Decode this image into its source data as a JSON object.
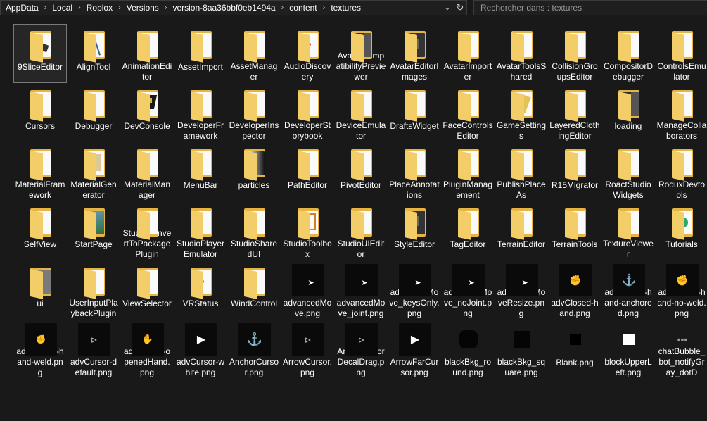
{
  "address": {
    "crumbs": [
      "AppData",
      "Local",
      "Roblox",
      "Versions",
      "version-8aa36bbf0eb1494a",
      "content",
      "textures"
    ],
    "separator": "›",
    "dropdown_icon": "chevron-down-icon",
    "refresh_icon": "refresh-icon"
  },
  "search": {
    "placeholder": "Rechercher dans : textures"
  },
  "accent_folder": "#e6b444",
  "items": [
    {
      "label": "9SliceEditor",
      "kind": "folder",
      "selected": true,
      "preview": "9slice"
    },
    {
      "label": "AlignTool",
      "kind": "folder",
      "preview": "align"
    },
    {
      "label": "AnimationEditor",
      "kind": "folder",
      "preview": "dot"
    },
    {
      "label": "AssetImport",
      "kind": "folder",
      "preview": "blank"
    },
    {
      "label": "AssetManager",
      "kind": "folder",
      "preview": "dot"
    },
    {
      "label": "AudioDiscovery",
      "kind": "folder",
      "preview": "red"
    },
    {
      "label": "AvatarCompatibilityPreviewer",
      "kind": "folder",
      "preview": "dark"
    },
    {
      "label": "AvatarEditorImages",
      "kind": "folder",
      "preview": "darkgrid"
    },
    {
      "label": "AvatarImporter",
      "kind": "folder",
      "preview": "dot"
    },
    {
      "label": "AvatarToolsShared",
      "kind": "folder",
      "preview": "dot"
    },
    {
      "label": "CollisionGroupsEditor",
      "kind": "folder",
      "preview": "dot"
    },
    {
      "label": "CompositorDebugger",
      "kind": "folder",
      "preview": "dot"
    },
    {
      "label": "ControlsEmulator",
      "kind": "folder",
      "preview": "blank"
    },
    {
      "label": "Cursors",
      "kind": "folder",
      "preview": "blank"
    },
    {
      "label": "Debugger",
      "kind": "folder",
      "preview": "dot"
    },
    {
      "label": "DevConsole",
      "kind": "folder",
      "preview": "devconsole"
    },
    {
      "label": "DeveloperFramework",
      "kind": "folder",
      "preview": "dot"
    },
    {
      "label": "DeveloperInspector",
      "kind": "folder",
      "preview": "dot"
    },
    {
      "label": "DeveloperStorybook",
      "kind": "folder",
      "preview": "blue"
    },
    {
      "label": "DeviceEmulator",
      "kind": "folder",
      "preview": "dot"
    },
    {
      "label": "DraftsWidget",
      "kind": "folder",
      "preview": "dot"
    },
    {
      "label": "FaceControlsEditor",
      "kind": "folder",
      "preview": "dot"
    },
    {
      "label": "GameSettings",
      "kind": "folder",
      "preview": "gold"
    },
    {
      "label": "LayeredClothingEditor",
      "kind": "folder",
      "preview": "dot"
    },
    {
      "label": "loading",
      "kind": "folder",
      "preview": "dark"
    },
    {
      "label": "ManageCollaborators",
      "kind": "folder",
      "preview": "blank"
    },
    {
      "label": "MaterialFramework",
      "kind": "folder",
      "preview": "blank"
    },
    {
      "label": "MaterialGenerator",
      "kind": "folder",
      "preview": "sketch"
    },
    {
      "label": "MaterialManager",
      "kind": "folder",
      "preview": "dot"
    },
    {
      "label": "MenuBar",
      "kind": "folder",
      "preview": "blank"
    },
    {
      "label": "particles",
      "kind": "folder",
      "preview": "gradient"
    },
    {
      "label": "PathEditor",
      "kind": "folder",
      "preview": "dot"
    },
    {
      "label": "PivotEditor",
      "kind": "folder",
      "preview": "dot"
    },
    {
      "label": "PlaceAnnotations",
      "kind": "folder",
      "preview": "dot"
    },
    {
      "label": "PluginManagement",
      "kind": "folder",
      "preview": "dot"
    },
    {
      "label": "PublishPlaceAs",
      "kind": "folder",
      "preview": "blue"
    },
    {
      "label": "R15Migrator",
      "kind": "folder",
      "preview": "dot"
    },
    {
      "label": "RoactStudioWidgets",
      "kind": "folder",
      "preview": "dot"
    },
    {
      "label": "RoduxDevtools",
      "kind": "folder",
      "preview": "blank"
    },
    {
      "label": "SelfView",
      "kind": "folder",
      "preview": "blank"
    },
    {
      "label": "StartPage",
      "kind": "folder",
      "preview": "green"
    },
    {
      "label": "StudioConvertToPackagePlugin",
      "kind": "folder",
      "preview": "blank"
    },
    {
      "label": "StudioPlayerEmulator",
      "kind": "folder",
      "preview": "dot"
    },
    {
      "label": "StudioSharedUI",
      "kind": "folder",
      "preview": "dot"
    },
    {
      "label": "StudioToolbox",
      "kind": "folder",
      "preview": "orange"
    },
    {
      "label": "StudioUIEditor",
      "kind": "folder",
      "preview": "dot"
    },
    {
      "label": "StyleEditor",
      "kind": "folder",
      "preview": "darkgrid"
    },
    {
      "label": "TagEditor",
      "kind": "folder",
      "preview": "dot"
    },
    {
      "label": "TerrainEditor",
      "kind": "folder",
      "preview": "dot"
    },
    {
      "label": "TerrainTools",
      "kind": "folder",
      "preview": "blank"
    },
    {
      "label": "TextureViewer",
      "kind": "folder",
      "preview": "blank"
    },
    {
      "label": "Tutorials",
      "kind": "folder",
      "preview": "check"
    },
    {
      "label": "ui",
      "kind": "folder",
      "preview": "ui"
    },
    {
      "label": "UserInputPlaybackPlugin",
      "kind": "folder",
      "preview": "blank"
    },
    {
      "label": "ViewSelector",
      "kind": "folder",
      "preview": "dot"
    },
    {
      "label": "VRStatus",
      "kind": "folder",
      "preview": "greendot"
    },
    {
      "label": "WindControl",
      "kind": "folder",
      "preview": "blank"
    },
    {
      "label": "advancedMove.png",
      "kind": "image",
      "glyph": "cursor-arrow-icon"
    },
    {
      "label": "advancedMove_joint.png",
      "kind": "image",
      "glyph": "cursor-arrow-icon"
    },
    {
      "label": "advancedMove_keysOnly.png",
      "kind": "image",
      "glyph": "cursor-arrow-icon"
    },
    {
      "label": "advancedMove_noJoint.png",
      "kind": "image",
      "glyph": "cursor-arrow-icon"
    },
    {
      "label": "advancedMoveResize.png",
      "kind": "image",
      "glyph": "cursor-arrow-icon"
    },
    {
      "label": "advClosed-hand.png",
      "kind": "image",
      "glyph": "closed-hand-icon"
    },
    {
      "label": "advClosed-hand-anchored.png",
      "kind": "image",
      "glyph": "anchor-hand-icon"
    },
    {
      "label": "advClosed-hand-no-weld.png",
      "kind": "image",
      "glyph": "closed-hand-icon"
    },
    {
      "label": "advClosed-hand-weld.png",
      "kind": "image",
      "glyph": "weld-hand-icon"
    },
    {
      "label": "advCursor-default.png",
      "kind": "image",
      "glyph": "cursor-outline-icon"
    },
    {
      "label": "advCursor-openedHand.png",
      "kind": "image",
      "glyph": "open-hand-icon"
    },
    {
      "label": "advCursor-white.png",
      "kind": "image",
      "glyph": "cursor-white-icon"
    },
    {
      "label": "AnchorCursor.png",
      "kind": "image",
      "glyph": "anchor-icon"
    },
    {
      "label": "ArrowCursor.png",
      "kind": "image",
      "glyph": "cursor-outline-icon"
    },
    {
      "label": "ArrowCursorDecalDrag.png",
      "kind": "image",
      "glyph": "cursor-outline-icon"
    },
    {
      "label": "ArrowFarCursor.png",
      "kind": "image",
      "glyph": "cursor-white-icon"
    },
    {
      "label": "blackBkg_round.png",
      "kind": "image",
      "glyph": "black-round-icon"
    },
    {
      "label": "blackBkg_square.png",
      "kind": "image",
      "glyph": "black-square-icon"
    },
    {
      "label": "Blank.png",
      "kind": "image",
      "glyph": "small-black-square-icon"
    },
    {
      "label": "blockUpperLeft.png",
      "kind": "image",
      "glyph": "white-square-icon"
    },
    {
      "label": "chatBubble_bot_notifyGray_dotD",
      "kind": "image",
      "glyph": "ellipsis-icon"
    }
  ]
}
